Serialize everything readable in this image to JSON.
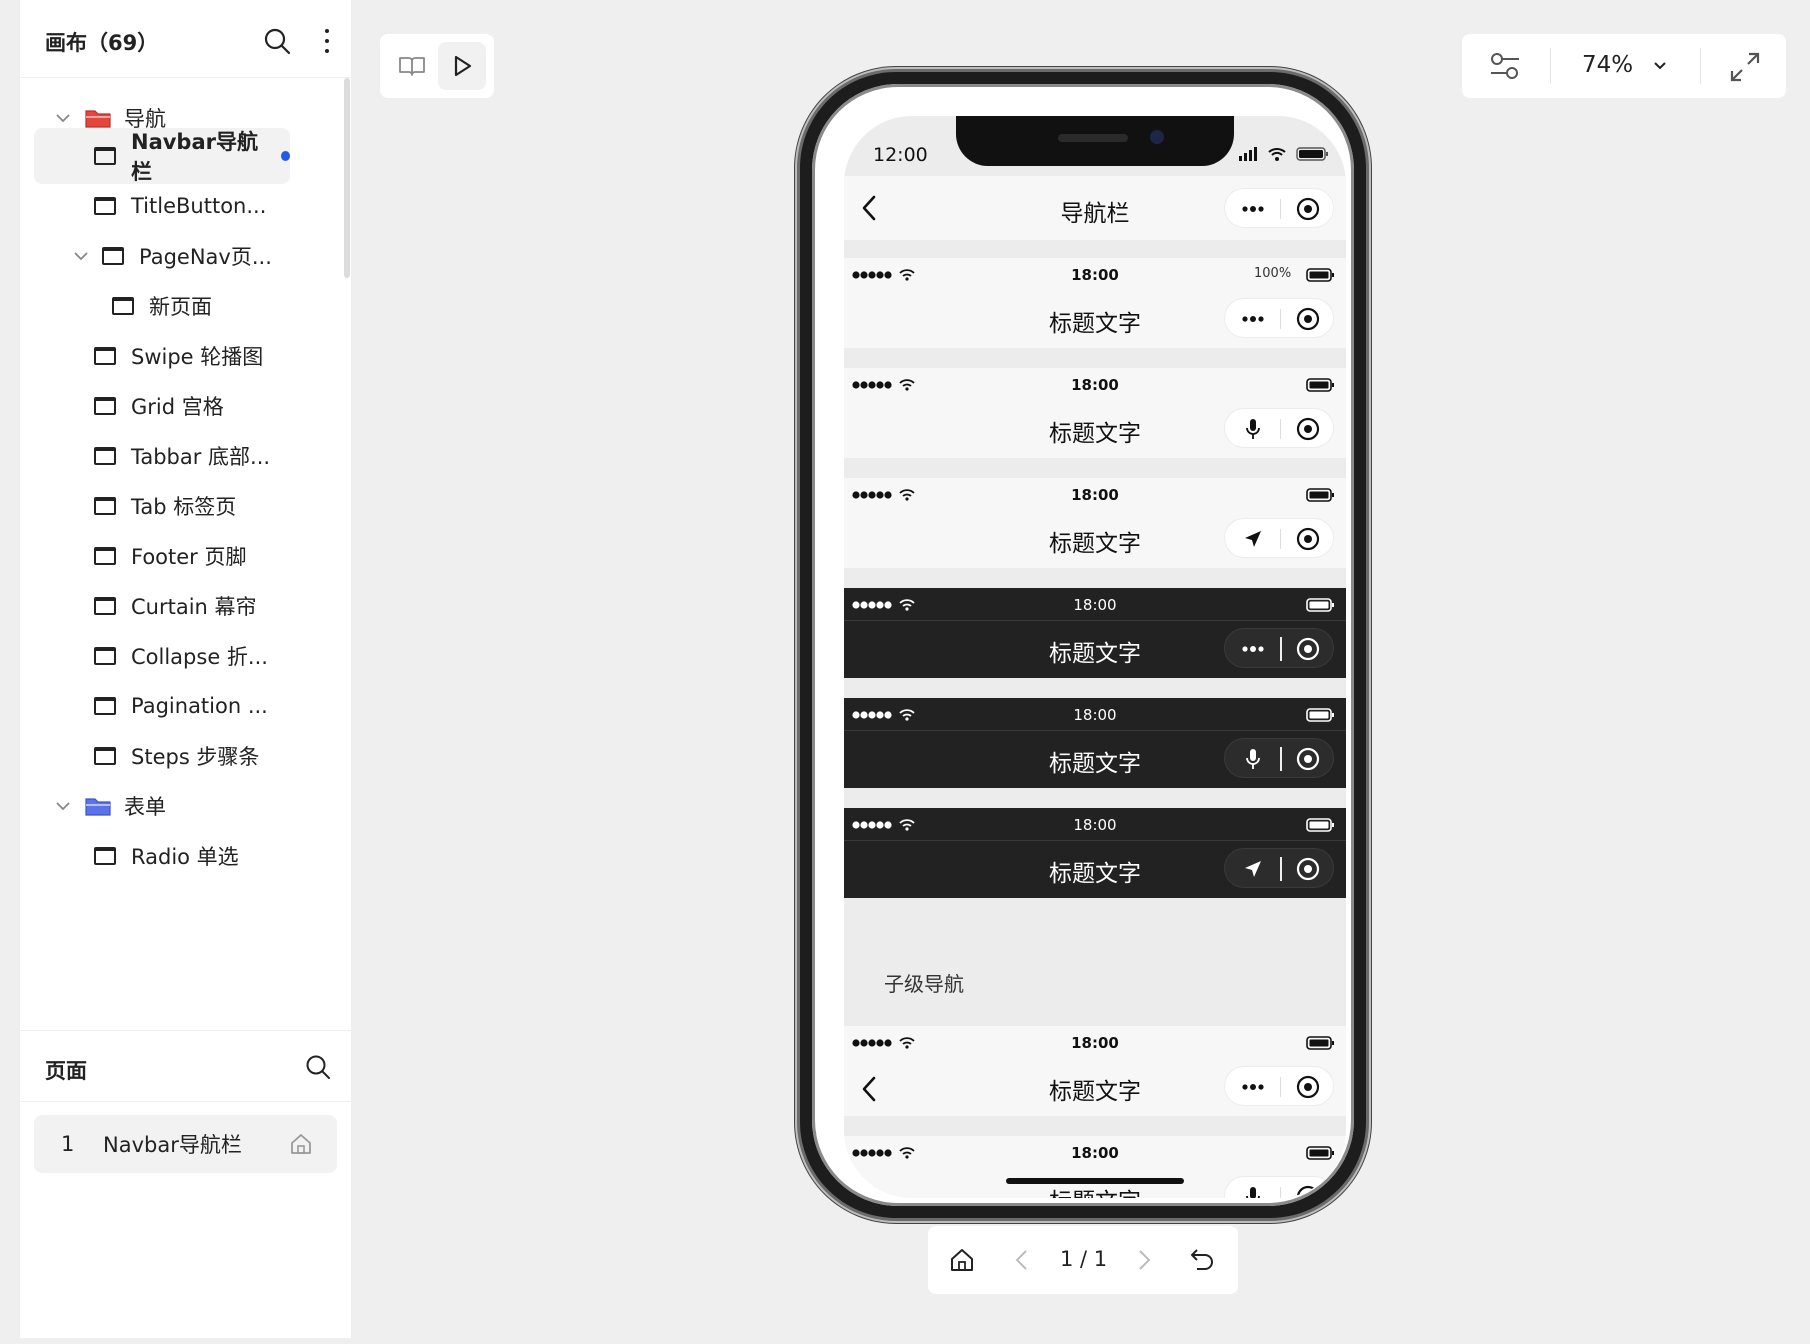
{
  "sidebar": {
    "title": "画布（69）",
    "tree": [
      {
        "label": "导航",
        "type": "folder",
        "color": "#e5463c",
        "expanded": true
      },
      {
        "label": "Navbar导航栏",
        "type": "page",
        "active": true
      },
      {
        "label": "TitleButton...",
        "type": "page"
      },
      {
        "label": "PageNav页...",
        "type": "page",
        "expanded": true
      },
      {
        "label": "新页面",
        "type": "page"
      },
      {
        "label": "Swipe 轮播图",
        "type": "page"
      },
      {
        "label": "Grid 宫格",
        "type": "page"
      },
      {
        "label": "Tabbar 底部...",
        "type": "page"
      },
      {
        "label": "Tab 标签页",
        "type": "page"
      },
      {
        "label": "Footer 页脚",
        "type": "page"
      },
      {
        "label": "Curtain 幕帘",
        "type": "page"
      },
      {
        "label": "Collapse 折...",
        "type": "page"
      },
      {
        "label": "Pagination ...",
        "type": "page"
      },
      {
        "label": "Steps 步骤条",
        "type": "page"
      },
      {
        "label": "表单",
        "type": "folder",
        "color": "#5b72e8",
        "expanded": true
      },
      {
        "label": "Radio 单选",
        "type": "page"
      }
    ],
    "pages_title": "页面",
    "pages": [
      {
        "num": "1",
        "label": "Navbar导航栏"
      }
    ]
  },
  "toolbar": {
    "zoom": "74%"
  },
  "phone": {
    "time": "12:00",
    "nav_title": "导航栏",
    "demo_time": "18:00",
    "demo_battery_pct": "100%",
    "demo_title": "标题文字",
    "sub_label": "子级导航"
  },
  "pager": {
    "text": "1 / 1"
  },
  "colors": {
    "accent": "#2459e7",
    "dark_bar": "#222222"
  }
}
